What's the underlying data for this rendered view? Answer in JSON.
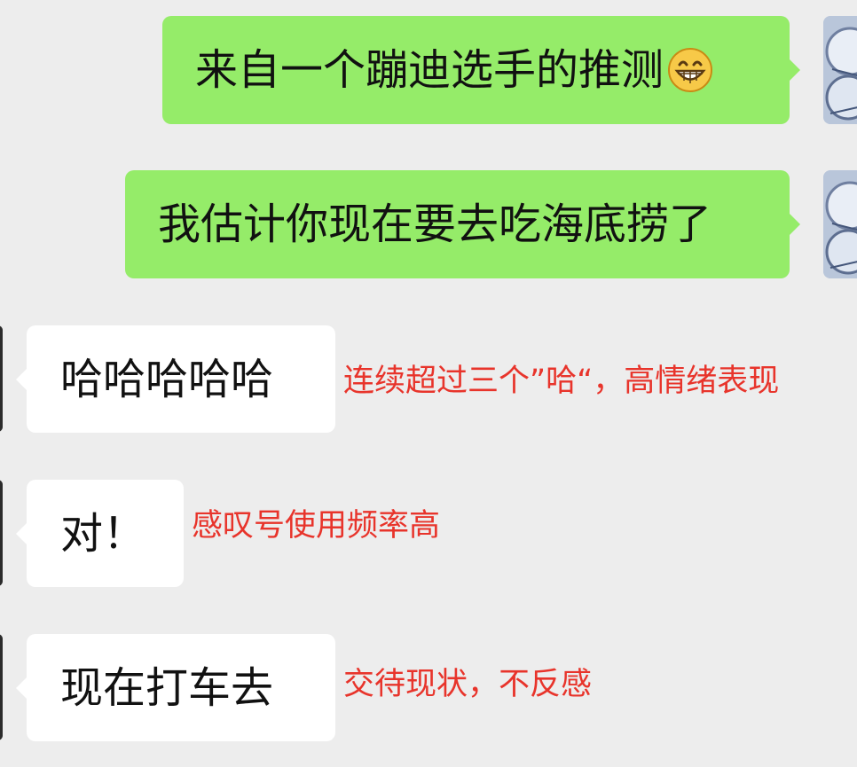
{
  "messages": [
    {
      "sender": "me",
      "text": "来自一个蹦迪选手的推测",
      "emoji": "grinning-face-emoji"
    },
    {
      "sender": "me",
      "text": "我估计你现在要去吃海底捞了"
    },
    {
      "sender": "other",
      "text": "哈哈哈哈哈",
      "annotation": "连续超过三个”哈“，高情绪表现"
    },
    {
      "sender": "other",
      "text": "对！",
      "annotation": "感叹号使用频率高"
    },
    {
      "sender": "other",
      "text": "现在打车去",
      "annotation": "交待现状，不反感"
    }
  ],
  "colors": {
    "background": "#ededed",
    "sent_bubble": "#95ec69",
    "received_bubble": "#ffffff",
    "annotation": "#e8342b"
  }
}
